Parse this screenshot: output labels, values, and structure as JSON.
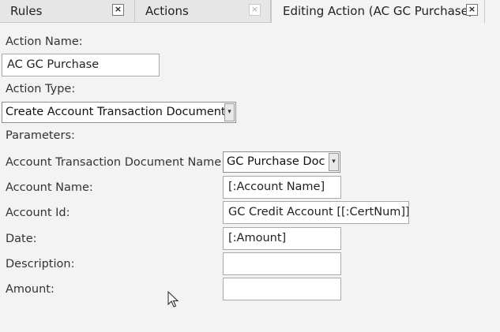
{
  "tabs": [
    {
      "label": "Rules",
      "close": "×"
    },
    {
      "label": "Actions",
      "close": "×"
    },
    {
      "label": "Editing Action (AC GC Purchase)",
      "close": "×"
    }
  ],
  "form": {
    "action_name_label": "Action Name:",
    "action_name_value": "AC GC Purchase",
    "action_type_label": "Action Type:",
    "action_type_value": "Create Account Transaction Document",
    "parameters_label": "Parameters:"
  },
  "params": {
    "doc_name_label": "Account Transaction Document Name:",
    "doc_name_value": "GC Purchase Doc",
    "account_name_label": "Account Name:",
    "account_name_value": "[:Account Name]",
    "account_id_label": "Account Id:",
    "account_id_value": "GC Credit Account [[:CertNum]]",
    "date_label": "Date:",
    "date_value": "[:Amount]",
    "description_label": "Description:",
    "description_value": "",
    "amount_label": "Amount:",
    "amount_value": ""
  },
  "icons": {
    "dropdown_arrow": "▾",
    "cursor": "mouse-pointer-icon"
  }
}
